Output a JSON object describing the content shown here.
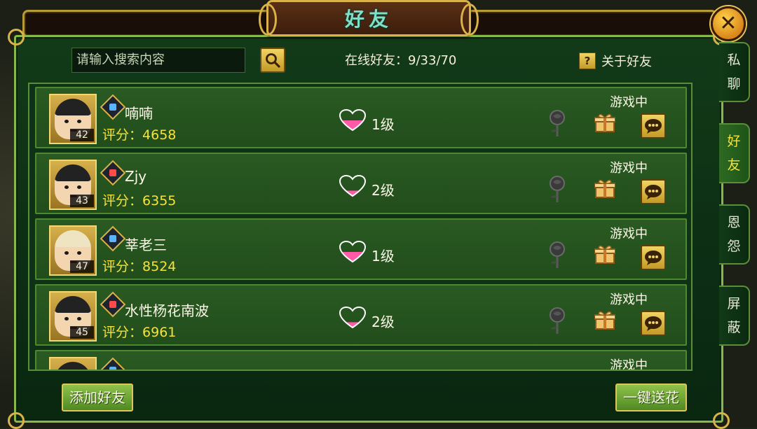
{
  "window": {
    "title": "好友",
    "close_label": "✕"
  },
  "search": {
    "placeholder": "请输入搜索内容"
  },
  "online": {
    "text": "在线好友：9/33/70"
  },
  "about": {
    "icon_text": "?",
    "label": "关于好友"
  },
  "side_tabs": [
    {
      "chars": [
        "私",
        "聊"
      ],
      "active": false
    },
    {
      "chars": [
        "好",
        "友"
      ],
      "active": true
    },
    {
      "chars": [
        "恩",
        "怨"
      ],
      "active": false
    },
    {
      "chars": [
        "屏",
        "蔽"
      ],
      "active": false
    }
  ],
  "friends": [
    {
      "name": "喃喃",
      "score_label": "评分：",
      "score": "4658",
      "level": "42",
      "intimacy": "1级",
      "intimacy_fill": 0.5,
      "status": "游戏中",
      "badge_color": "#5ab4ff"
    },
    {
      "name": "Zjy",
      "score_label": "评分：",
      "score": "6355",
      "level": "43",
      "intimacy": "2级",
      "intimacy_fill": 0.3,
      "status": "游戏中",
      "badge_color": "#ff4a4a"
    },
    {
      "name": "莘老三",
      "score_label": "评分：",
      "score": "8524",
      "level": "47",
      "intimacy": "1级",
      "intimacy_fill": 0.5,
      "status": "游戏中",
      "badge_color": "#5ab4ff"
    },
    {
      "name": "水性杨花南波",
      "score_label": "评分：",
      "score": "6961",
      "level": "45",
      "intimacy": "2级",
      "intimacy_fill": 0.3,
      "status": "游戏中",
      "badge_color": "#ff4a4a"
    },
    {
      "name": "",
      "score_label": "",
      "score": "",
      "level": "",
      "intimacy": "",
      "intimacy_fill": 0,
      "status": "游戏中",
      "badge_color": "#5ab4ff"
    }
  ],
  "buttons": {
    "add_friend": "添加好友",
    "send_flowers": "一键送花"
  },
  "colors": {
    "panel": "#123a18",
    "border_gold": "#d9b24a",
    "score": "#f6e23a",
    "heart_fill": "#ff5aa8"
  }
}
